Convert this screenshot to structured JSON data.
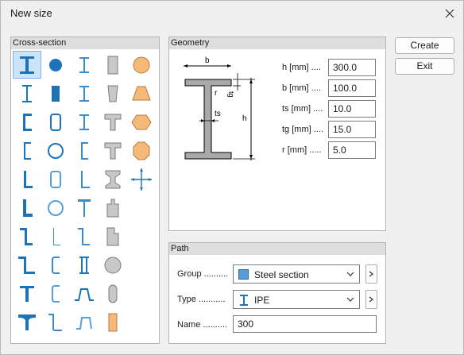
{
  "window": {
    "title": "New size"
  },
  "buttons": {
    "create": "Create",
    "exit": "Exit"
  },
  "cross_section": {
    "title": "Cross-section",
    "icons": [
      "i-beam-icon",
      "circle-solid-icon",
      "i-beam-thin-icon",
      "rect-gray-icon",
      "circle-orange-icon",
      "i-beam-narrow-icon",
      "rect-solid-icon",
      "i-beam-thin-icon",
      "trapezoid-gray-icon",
      "trapezoid-orange-icon",
      "channel-icon",
      "rounded-rect-hollow-icon",
      "i-beam-thin-icon",
      "t-gray-icon",
      "hexagon-orange-icon",
      "channel-thin-icon",
      "circle-hollow-icon",
      "channel-light-icon",
      "t-gray-round-icon",
      "octagon-orange-icon",
      "angle-icon",
      "rounded-rect-light-icon",
      "angle-light-icon",
      "i-gray-icon",
      "custom-dimension-icon",
      "angle-thick-icon",
      "circle-light-icon",
      "tee-thin-icon",
      "plate-gray-icon",
      "",
      "z-section-icon",
      "angle-thin-icon",
      "z-light-icon",
      "plate-notch-gray-icon",
      "",
      "z-section-wide-icon",
      "channel-rounded-icon",
      "i-hollow-icon",
      "circle-gray-icon",
      "",
      "tee-icon",
      "channel-rounded-light-icon",
      "trapezoid-hat-icon",
      "stadium-gray-icon",
      "",
      "tee-wide-icon",
      "z-curved-icon",
      "trapezoid-light-icon",
      "rect-orange-icon",
      ""
    ]
  },
  "geometry": {
    "title": "Geometry",
    "diagram_labels": {
      "b": "b",
      "h": "h",
      "r": "r",
      "tg": "tg",
      "ts": "ts"
    },
    "fields": [
      {
        "label": "h [mm] ....",
        "value": "300.0"
      },
      {
        "label": "b [mm] ....",
        "value": "100.0"
      },
      {
        "label": "ts [mm] ....",
        "value": "10.0"
      },
      {
        "label": "tg [mm] ....",
        "value": "15.0"
      },
      {
        "label": "r [mm] .....",
        "value": "5.0"
      }
    ]
  },
  "path": {
    "title": "Path",
    "group_label": "Group ..........",
    "group_value": "Steel section",
    "type_label": "Type ...........",
    "type_value": "IPE",
    "name_label": "Name ..........",
    "name_value": "300"
  },
  "colors": {
    "blue": "#1e72b8",
    "orange": "#f5b97a",
    "gray": "#c8c8c8",
    "selection": "#cce4f7"
  }
}
